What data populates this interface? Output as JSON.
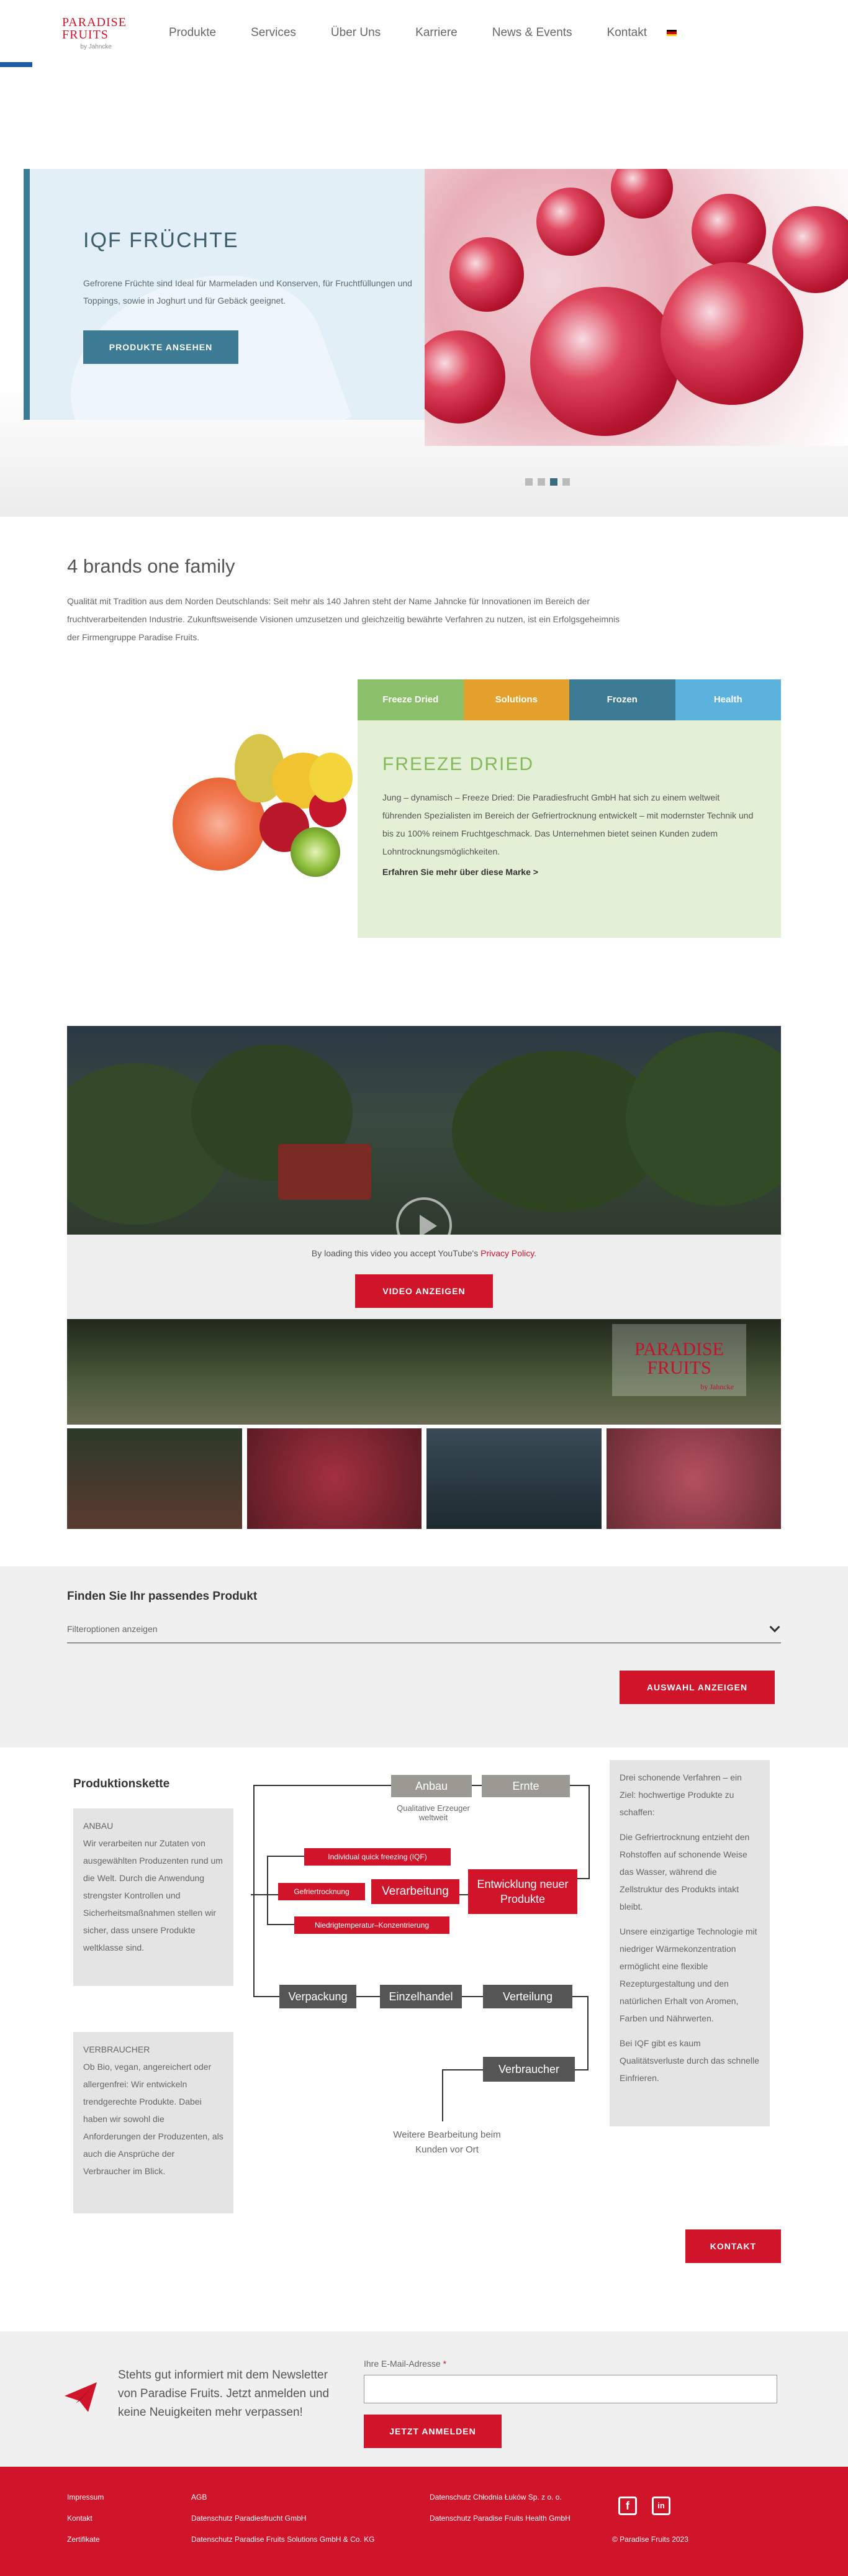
{
  "header": {
    "logo_main": "PARADISE FRUITS",
    "logo_sub": "by Jahncke",
    "nav": [
      "Produkte",
      "Services",
      "Über Uns",
      "Karriere",
      "News & Events",
      "Kontakt"
    ]
  },
  "hero": {
    "title": "IQF FRÜCHTE",
    "text": "Gefrorene Früchte sind Ideal für Marmeladen und Konserven, für Fruchtfüllungen und Toppings, sowie in Joghurt und für Gebäck geeignet.",
    "button": "PRODUKTE ANSEHEN",
    "slides": 4,
    "active_slide": 3
  },
  "brands": {
    "title": "4 brands one family",
    "text": "Qualität mit Tradition aus dem Norden Deutschlands: Seit mehr als 140 Jahren steht der Name Jahncke für Innovationen im Bereich der fruchtverarbeitenden Industrie. Zukunftsweisende Visionen umzusetzen und gleichzeitig bewährte Verfahren zu nutzen, ist ein Erfolgsgeheimnis der Firmengruppe Paradise Fruits.",
    "tabs": [
      {
        "label": "Freeze Dried",
        "color": "#8cbf6a"
      },
      {
        "label": "Solutions",
        "color": "#e3a02d"
      },
      {
        "label": "Frozen",
        "color": "#3d7b94"
      },
      {
        "label": "Health",
        "color": "#5bb2dc"
      }
    ],
    "panel_title": "FREEZE DRIED",
    "panel_text": "Jung – dynamisch – Freeze Dried: Die Paradiesfrucht GmbH hat sich zu einem weltweit führenden Spezialisten im Bereich der Gefriertrocknung entwickelt – mit modernster Technik und bis zu 100% reinem Fruchtgeschmack. Das Unternehmen bietet seinen Kunden zudem Lohntrocknungsmöglichkeiten.",
    "panel_link": "Erfahren Sie mehr über diese Marke >"
  },
  "video": {
    "consent_text": "By loading this video you accept YouTube's",
    "consent_link": "Privacy Policy",
    "consent_end": ".",
    "button": "VIDEO ANZEIGEN",
    "logo_main": "PARADISE FRUITS",
    "logo_sub": "by Jahncke"
  },
  "finder": {
    "title": "Finden Sie Ihr passendes Produkt",
    "select": "Filteroptionen anzeigen",
    "button": "AUSWAHL ANZEIGEN"
  },
  "chain": {
    "title": "Produktionskette",
    "anbau_head": "ANBAU",
    "anbau_text": "Wir verarbeiten nur Zutaten von ausgewählten Produzenten rund um die Welt. Durch die Anwendung strengster Kontrollen und Sicherheitsmaßnahmen stellen wir sicher, dass unsere Produkte weltklasse sind.",
    "verbraucher_head": "VERBRAUCHER",
    "verbraucher_text": "Ob Bio, vegan, angereichert oder allergenfrei: Wir entwickeln trendgerechte Produkte. Dabei haben wir sowohl die Anforderungen der Produzenten, als auch die Ansprüche der Verbraucher im Blick.",
    "side": [
      "Drei schonende Verfahren – ein Ziel: hochwertige Produkte zu schaffen:",
      "Die Gefriertrocknung entzieht den Rohstoffen auf schonende Weise das Wasser, während die Zellstruktur des Produkts intakt bleibt.",
      "Unsere einzigartige Technologie mit niedriger Wärmekonzentration ermöglicht eine flexible Rezepturgestaltung und den natürlichen Erhalt von Aromen, Farben und Nährwerten.",
      "Bei IQF gibt es kaum Qualitätsverluste durch das schnelle Einfrieren."
    ],
    "nodes": {
      "anbau": "Anbau",
      "ernte": "Ernte",
      "anbau_note": "Qualitative Erzeuger weltweit",
      "iqf": "Individual quick freezing (IQF)",
      "gefrier": "Gefriertrocknung",
      "verarbeitung": "Verarbeitung",
      "entwicklung": "Entwicklung neuer Produkte",
      "niedrig": "Niedrigtemperatur–Konzentrierung",
      "verpackung": "Verpackung",
      "einzelhandel": "Einzelhandel",
      "verteilung": "Verteilung",
      "verbraucher": "Verbraucher",
      "weitere": "Weitere Bearbeitung beim Kunden vor Ort"
    },
    "contact_button": "KONTAKT"
  },
  "newsletter": {
    "text": "Stehts gut informiert mit dem Newsletter von Paradise Fruits. Jetzt anmelden und keine Neuigkeiten mehr verpassen!",
    "label": "Ihre E-Mail-Adresse",
    "required": "*",
    "button": "JETZT ANMELDEN"
  },
  "footer": {
    "col1": [
      "Impressum",
      "Kontakt",
      "Zertifikate"
    ],
    "col2": [
      "AGB",
      "Datenschutz Paradiesfrucht GmbH",
      "Datenschutz Paradise Fruits Solutions GmbH & Co. KG"
    ],
    "col3": [
      "Datenschutz Chłodnia Łuków Sp. z o. o.",
      "Datenschutz Paradise Fruits Health GmbH"
    ],
    "copyright": "© Paradise Fruits 2023",
    "icons": [
      "facebook-icon",
      "linkedin-icon"
    ]
  },
  "colors": {
    "accent_red": "#d0142a",
    "blue": "#3d7b94",
    "green": "#8cbf6a"
  }
}
